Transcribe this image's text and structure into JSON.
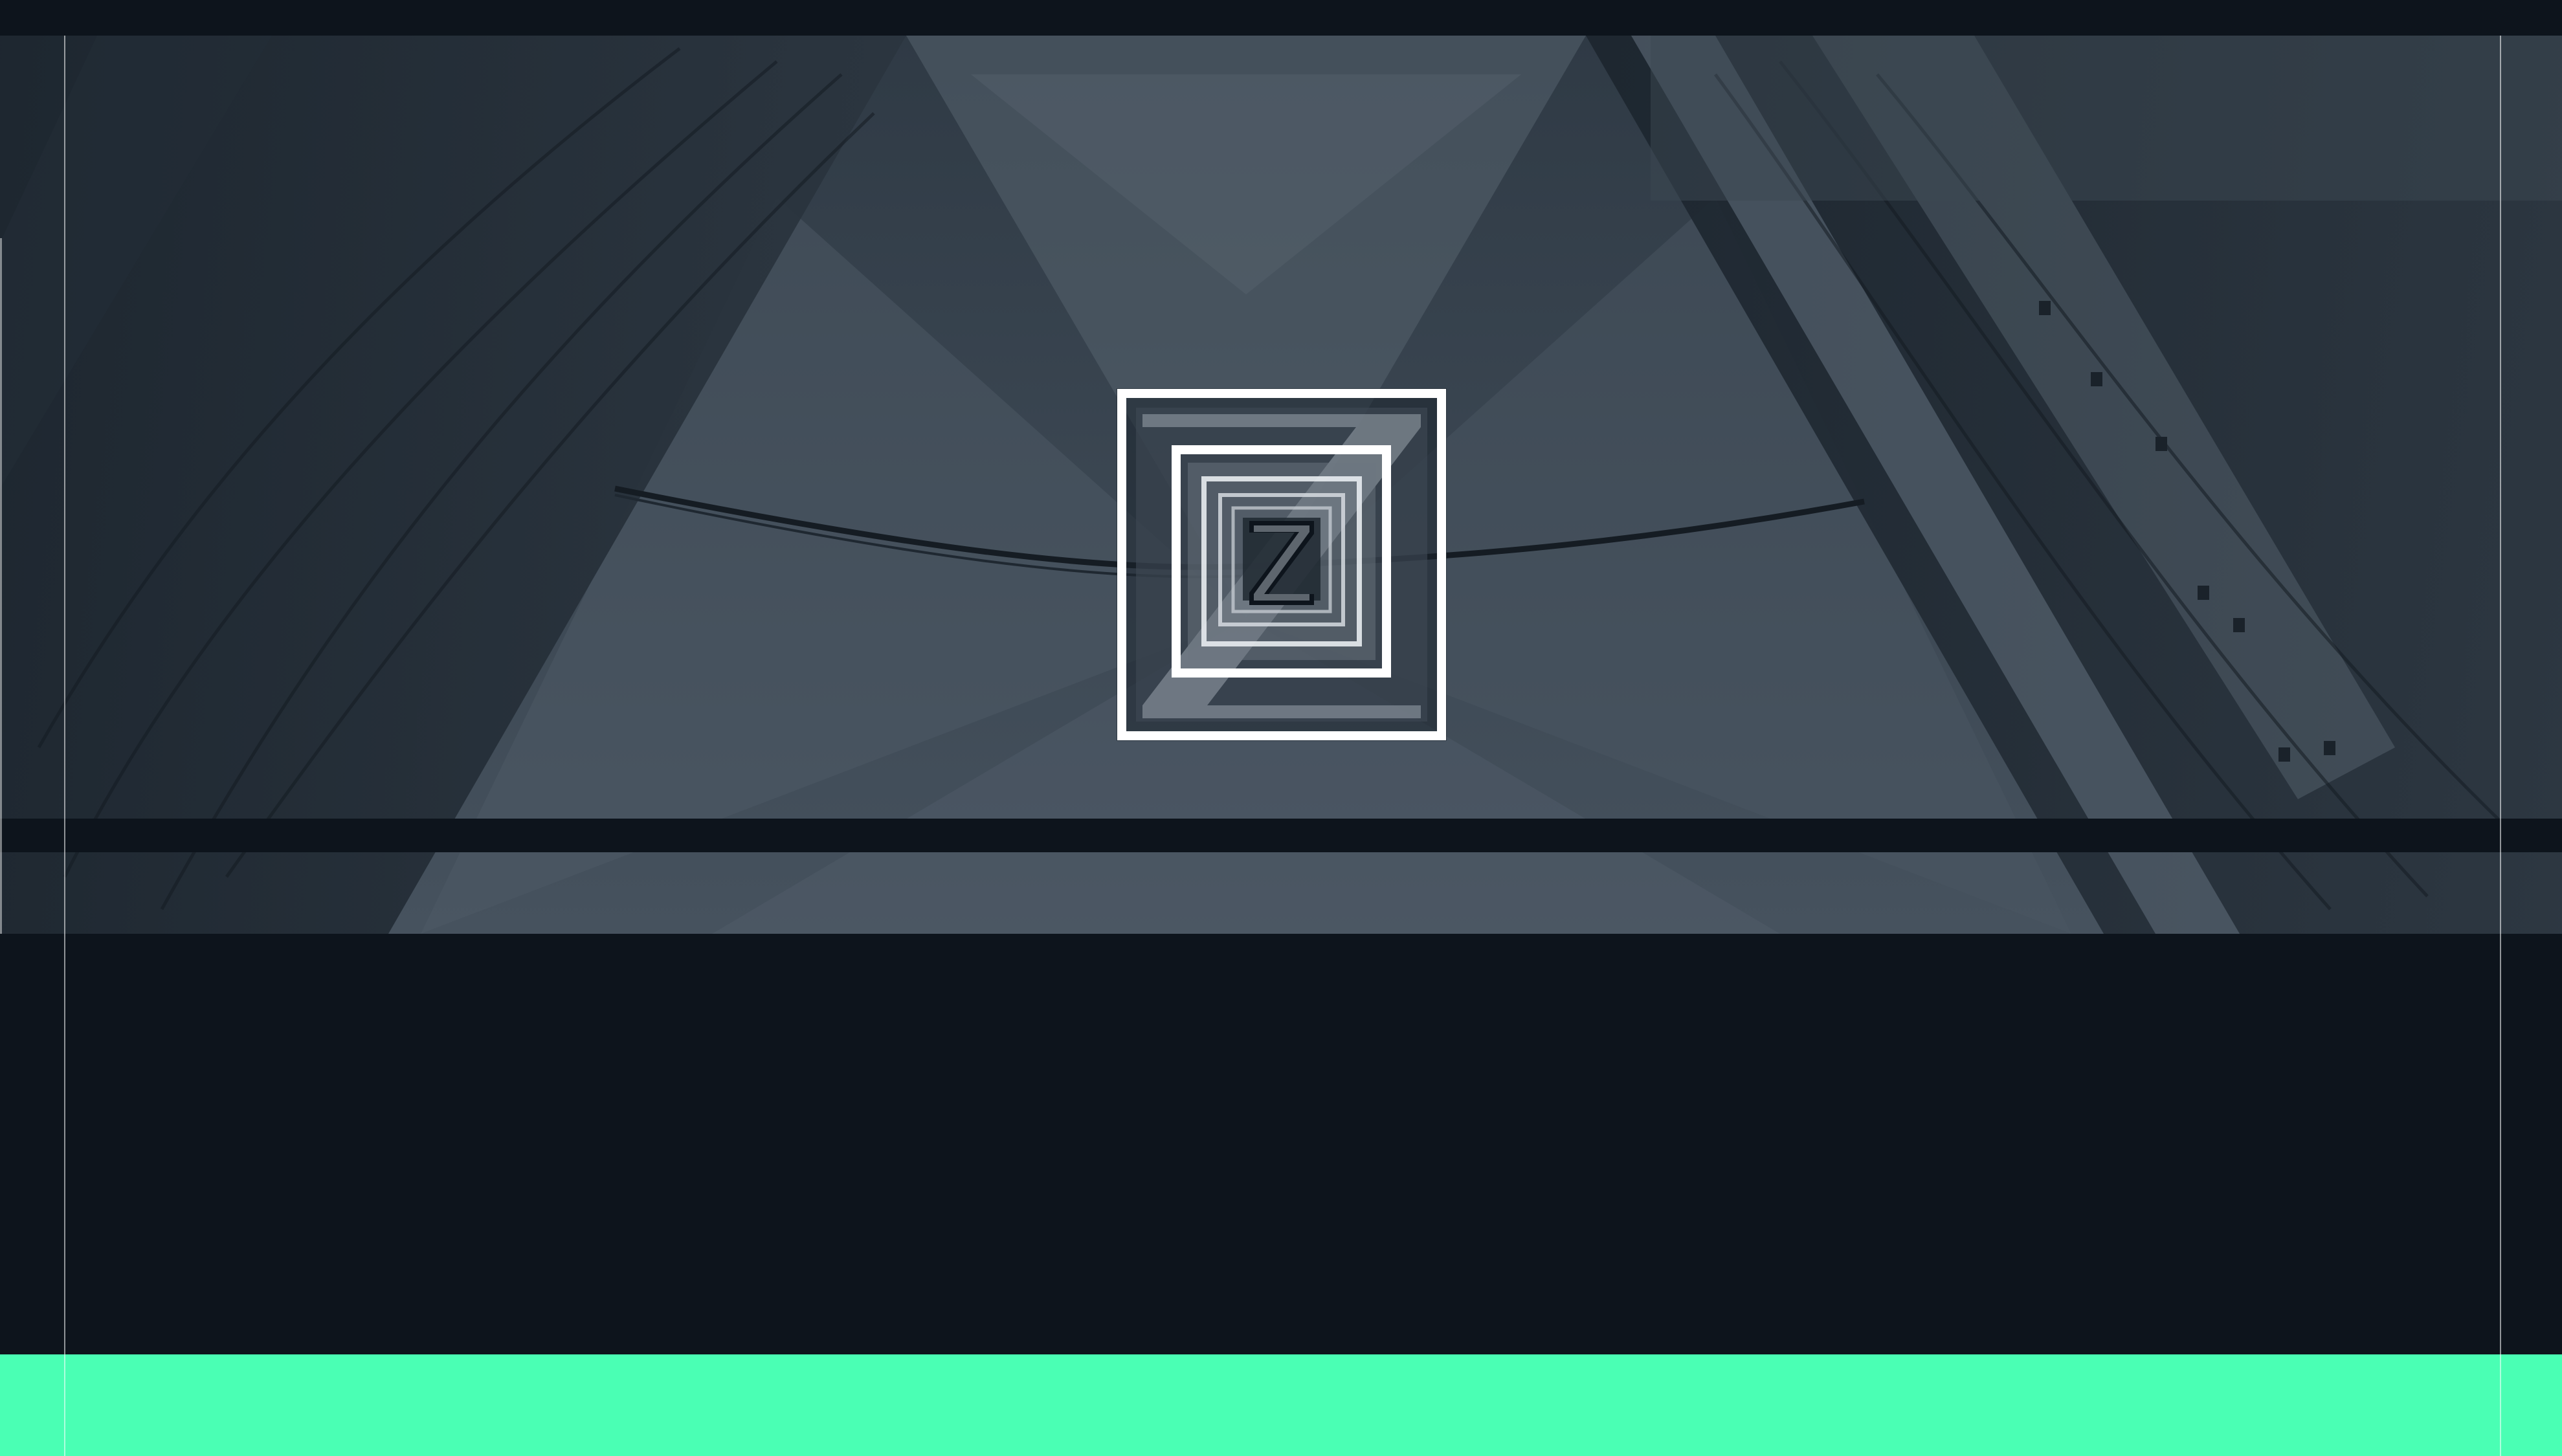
{
  "colors": {
    "page_background": "#0d141c",
    "hero_tint": "#3a4550",
    "accent_bar": "#4affb4",
    "logo_frame": "#ffffff"
  },
  "hero": {
    "image": "triangular-steel-structure-photo",
    "logo": {
      "icon": "z-logo-icon",
      "glyph": "Z"
    }
  },
  "footer_bar": {
    "color_ref": "accent_bar"
  }
}
